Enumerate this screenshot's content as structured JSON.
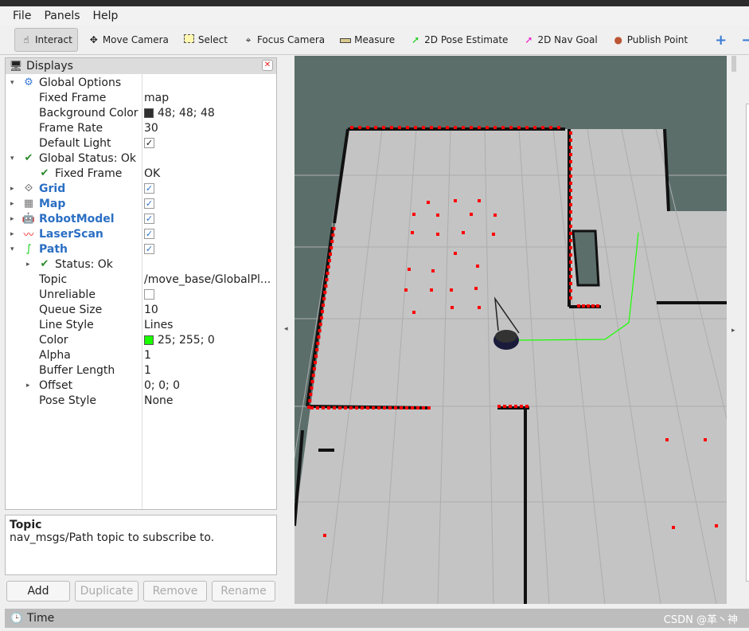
{
  "menu": [
    "File",
    "Panels",
    "Help"
  ],
  "toolbar": {
    "tools": [
      {
        "label": "Interact",
        "icon": "hand-pointer-icon"
      },
      {
        "label": "Move Camera",
        "icon": "move-camera-icon"
      },
      {
        "label": "Select",
        "icon": "select-box-icon"
      },
      {
        "label": "Focus Camera",
        "icon": "focus-crosshair-icon"
      },
      {
        "label": "Measure",
        "icon": "ruler-icon"
      },
      {
        "label": "2D Pose Estimate",
        "icon": "green-arrow-icon"
      },
      {
        "label": "2D Nav Goal",
        "icon": "magenta-arrow-icon"
      },
      {
        "label": "Publish Point",
        "icon": "map-pin-icon"
      }
    ],
    "active": "Interact"
  },
  "displays": {
    "title": "Displays",
    "rows": [
      {
        "label": "Global Options",
        "value": ""
      },
      {
        "label": "Fixed Frame",
        "value": "map"
      },
      {
        "label": "Background Color",
        "value": "48; 48; 48",
        "color": "#303030"
      },
      {
        "label": "Frame Rate",
        "value": "30"
      },
      {
        "label": "Default Light",
        "value": ""
      },
      {
        "label": "Global Status: Ok",
        "value": ""
      },
      {
        "label": "Fixed Frame",
        "value": "OK"
      },
      {
        "label": "Grid",
        "value": ""
      },
      {
        "label": "Map",
        "value": ""
      },
      {
        "label": "RobotModel",
        "value": ""
      },
      {
        "label": "LaserScan",
        "value": ""
      },
      {
        "label": "Path",
        "value": ""
      },
      {
        "label": "Status: Ok",
        "value": ""
      },
      {
        "label": "Topic",
        "value": "/move_base/GlobalPl..."
      },
      {
        "label": "Unreliable",
        "value": ""
      },
      {
        "label": "Queue Size",
        "value": "10"
      },
      {
        "label": "Line Style",
        "value": "Lines"
      },
      {
        "label": "Color",
        "value": "25; 255; 0",
        "color": "#19ff00"
      },
      {
        "label": "Alpha",
        "value": "1"
      },
      {
        "label": "Buffer Length",
        "value": "1"
      },
      {
        "label": "Offset",
        "value": "0; 0; 0"
      },
      {
        "label": "Pose Style",
        "value": "None"
      }
    ]
  },
  "description": {
    "title": "Topic",
    "text": "nav_msgs/Path topic to subscribe to."
  },
  "buttons": {
    "add": "Add",
    "duplicate": "Duplicate",
    "remove": "Remove",
    "rename": "Rename"
  },
  "time": {
    "label": "Time"
  },
  "watermark": "CSDN @革丶神",
  "colors": {
    "laser": "#ff0000",
    "path": "#19ff00",
    "floor": "#c4c4c4",
    "background": "#5b6e6a"
  }
}
